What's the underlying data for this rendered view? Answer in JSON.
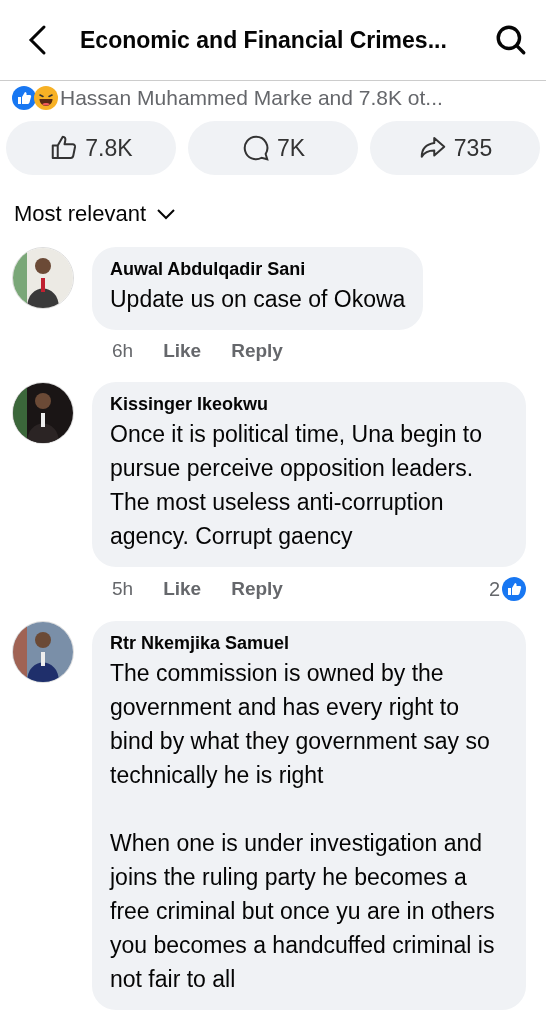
{
  "header": {
    "title": "Economic and Financial Crimes..."
  },
  "reactions": {
    "summary": "Hassan Muhammed Marke and 7.8K ot..."
  },
  "actions": [
    {
      "kind": "like",
      "count": "7.8K"
    },
    {
      "kind": "comment",
      "count": "7K"
    },
    {
      "kind": "share",
      "count": "735"
    }
  ],
  "sort": {
    "label": "Most relevant"
  },
  "comments": [
    {
      "author": "Auwal Abdulqadir Sani",
      "text": "Update us on case of Okowa",
      "time": "6h",
      "like": "Like",
      "reply": "Reply"
    },
    {
      "author": "Kissinger Ikeokwu",
      "text": "Once it is political time, Una begin to pursue perceive opposition leaders. The most useless anti-corruption agency. Corrupt gaency",
      "time": "5h",
      "like": "Like",
      "reply": "Reply",
      "reaction_count": "2"
    },
    {
      "author": "Rtr Nkemjika Samuel",
      "text": "The commission is owned by the government and has every right to bind by what they government say so technically he is right\n\nWhen one is under investigation and joins the ruling party he becomes a free criminal but once yu are in others you becomes a handcuffed criminal is not fair to all"
    }
  ]
}
